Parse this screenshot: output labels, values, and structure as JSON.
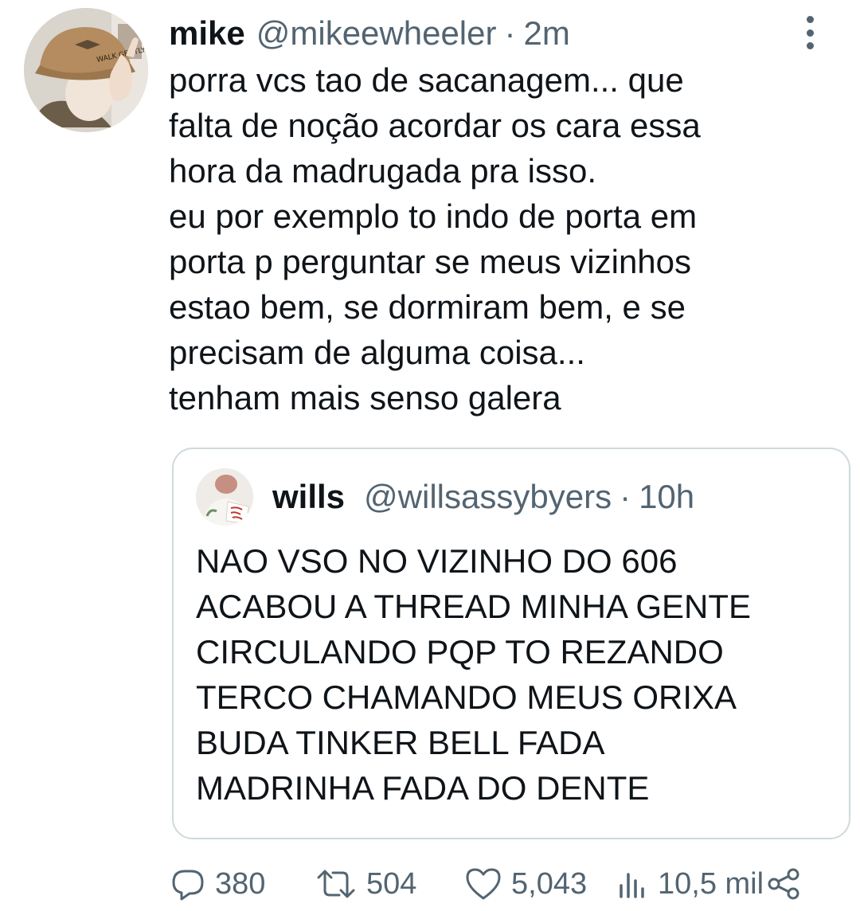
{
  "tweet": {
    "author": {
      "name": "mike",
      "handle": "@mikeewheeler",
      "separator": "·",
      "time": "2m"
    },
    "lines": [
      "porra vcs tao de sacanagem... que",
      "falta de noção acordar os cara essa",
      "hora da madrugada pra isso.",
      "eu por exemplo to indo de porta em",
      "porta p perguntar se meus vizinhos",
      "estao bem, se dormiram bem, e se",
      "precisam de alguma coisa...",
      "tenham mais senso galera"
    ],
    "avatar_cap_text": "WALK GENTLY"
  },
  "quote": {
    "author": {
      "name": "wills",
      "handle": "@willsassybyers",
      "separator": "·",
      "time": "10h"
    },
    "lines": [
      "NAO VSO NO VIZINHO DO 606",
      "ACABOU A THREAD MINHA GENTE",
      "CIRCULANDO PQP TO REZANDO",
      "TERCO CHAMANDO MEUS ORIXA",
      "BUDA TINKER BELL FADA",
      "MADRINHA FADA DO DENTE"
    ]
  },
  "actions": {
    "reply": {
      "icon": "reply-icon",
      "count": "380"
    },
    "retweet": {
      "icon": "retweet-icon",
      "count": "504"
    },
    "like": {
      "icon": "heart-icon",
      "count": "5,043"
    },
    "views": {
      "icon": "views-icon",
      "count": "10,5 mil"
    },
    "share": {
      "icon": "share-icon"
    }
  },
  "colors": {
    "text": "#0f1419",
    "secondary": "#536471",
    "border": "#cfd9de",
    "background": "#ffffff"
  }
}
